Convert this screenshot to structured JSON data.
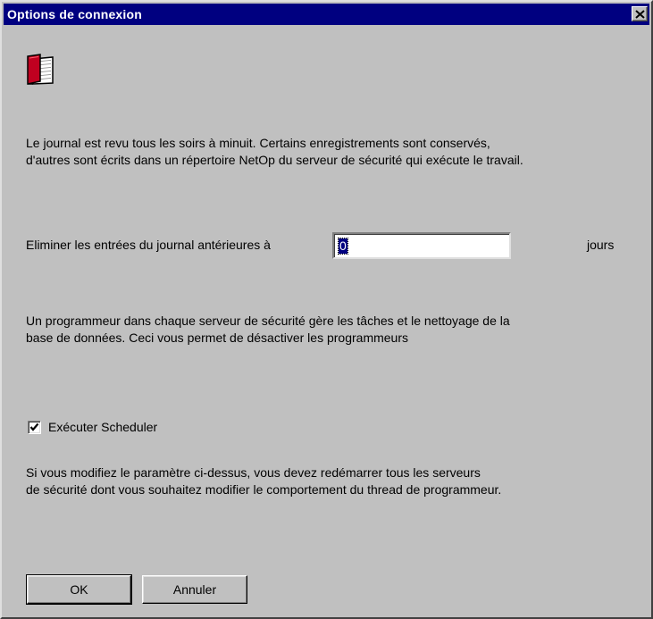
{
  "window": {
    "title": "Options de connexion",
    "close_label": "×"
  },
  "icons": {
    "header_icon": "book-icon",
    "close_icon": "close-icon",
    "check_icon": "checkmark-icon"
  },
  "colors": {
    "titlebar": "#000080",
    "dialog_bg": "#c0c0c0",
    "selection": "#000080"
  },
  "content": {
    "intro_line1": "Le journal est revu tous les soirs à minuit. Certains enregistrements sont conservés,",
    "intro_line2": "d'autres sont écrits dans un répertoire NetOp du serveur de sécurité qui exécute le travail.",
    "purge_label": "Eliminer les entrées du journal antérieures à",
    "purge_value": "0",
    "purge_unit": "jours",
    "scheduler_line1": "Un programmeur dans chaque serveur de sécurité gère les tâches et le nettoyage de la",
    "scheduler_line2": "base de données. Ceci vous permet de désactiver les programmeurs",
    "run_scheduler_label": "Exécuter Scheduler",
    "run_scheduler_checked": true,
    "note_line1": "Si vous modifiez le paramètre ci-dessus, vous devez redémarrer tous les serveurs",
    "note_line2": "de sécurité dont vous souhaitez modifier le comportement du thread de programmeur."
  },
  "buttons": {
    "ok_label": "OK",
    "cancel_label": "Annuler"
  }
}
